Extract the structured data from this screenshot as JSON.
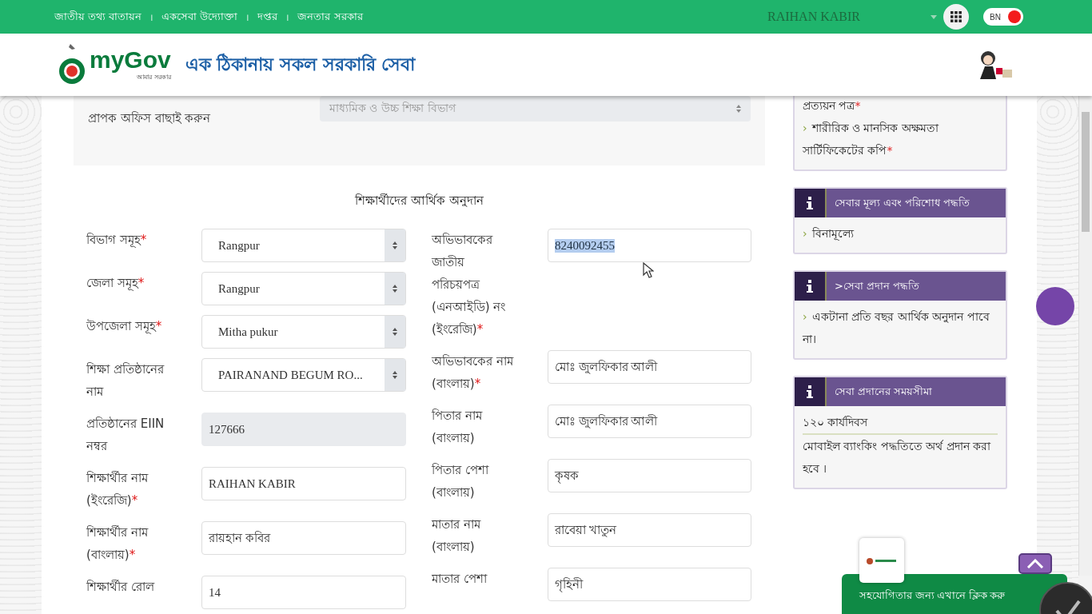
{
  "top_nav": {
    "links": [
      "জাতীয় তথ্য বাতায়ন",
      "একসেবা উদ্যোক্তা",
      "দপ্তর",
      "জনতার সরকার"
    ],
    "separator": "।",
    "user_name": "RAIHAN KABIR",
    "lang_toggle": {
      "label": "BN",
      "on": true
    }
  },
  "header": {
    "logo_text": "myGov",
    "logo_subtext": "আমার সরকার",
    "tagline": "এক ঠিকানায় সকল সরকারি সেবা"
  },
  "office_select": {
    "label": "প্রাপক অফিস বাছাই করুন",
    "value": "মাধ্যমিক ও উচ্চ শিক্ষা বিভাগ",
    "disabled": true
  },
  "form_title": "শিক্ষার্থীদের আর্থিক অনুদান",
  "left_fields": [
    {
      "label": "বিভাগ সমূহ",
      "mark": "*",
      "kind": "select",
      "value": "Rangpur"
    },
    {
      "label": "জেলা সমূহ",
      "mark": "*",
      "kind": "select",
      "value": "Rangpur"
    },
    {
      "label": "উপজেলা সমূহ",
      "mark": "*",
      "kind": "select",
      "value": "Mitha pukur"
    },
    {
      "label": "শিক্ষা প্রতিষ্ঠানের নাম",
      "kind": "select",
      "value": "PAIRANAND BEGUM RO..."
    },
    {
      "label": "প্রতিষ্ঠানের EIIN নম্বর",
      "kind": "readonly",
      "value": "127666"
    },
    {
      "label": "শিক্ষার্থীর নাম (ইংরেজি)",
      "mark": "*",
      "kind": "input",
      "value": "RAIHAN KABIR"
    },
    {
      "label": "শিক্ষার্থীর নাম (বাংলায়)",
      "mark": "*",
      "kind": "input",
      "value": "রায়হান কবির"
    },
    {
      "label": "শিক্ষার্থীর রোল",
      "kind": "input",
      "value": "14"
    }
  ],
  "right_fields": [
    {
      "label": "অভিভাবকের জাতীয় পরিচয়পত্র (এনআইডি) নং (ইংরেজি)",
      "mark": "*",
      "kind": "input",
      "value": "8240092455",
      "highlighted": true
    },
    {
      "label": "অভিভাবকের নাম (বাংলায়)",
      "mark": "*",
      "kind": "input",
      "value": "মোঃ জুলফিকার আলী",
      "highlighted": false
    },
    {
      "label": "পিতার নাম (বাংলায়)",
      "kind": "input",
      "value": "মোঃ জুলফিকার আলী",
      "highlighted": false
    },
    {
      "label": "পিতার পেশা (বাংলায়)",
      "kind": "input",
      "value": "কৃষক",
      "highlighted": false
    },
    {
      "label": "মাতার নাম (বাংলায়)",
      "kind": "input",
      "value": "রাবেয়া খাতুন",
      "highlighted": false
    },
    {
      "label": "মাতার পেশা",
      "kind": "input",
      "value": "গৃহিনী",
      "highlighted": false
    }
  ],
  "sidebar": {
    "documents": [
      {
        "text": "প্রত্যয়ন পত্র",
        "mark": "*"
      },
      {
        "bullet": "›",
        "text": "শারীরিক ও মানসিক অক্ষমতা সার্টিফিকেটের কপি",
        "mark": "*"
      }
    ],
    "cards": [
      {
        "title": "সেবার মূল্য এবং পরিশোধ পদ্ধতি",
        "items": [
          {
            "bullet": "›",
            "text": "বিনামূল্যে",
            "kind": "text"
          }
        ]
      },
      {
        "title": ">সেবা প্রদান পদ্ধতি",
        "items": [
          {
            "bullet": "›",
            "text": "একটানা প্রতি বছর আর্থিক অনুদান পাবে না।",
            "kind": "text"
          }
        ]
      },
      {
        "title": "সেবা প্রদানের সময়সীমা",
        "items": [
          {
            "text": "১২০ কার্যদিবস",
            "kind": "text"
          },
          {
            "text": "মোবাইল ব্যাংকিং পদ্ধতিতে অর্থ প্রদান করা হবে ।",
            "kind": "ruled"
          }
        ]
      }
    ]
  },
  "help_button": {
    "label": "সহযোগিতার জন্য এখানে ক্লিক করু"
  }
}
